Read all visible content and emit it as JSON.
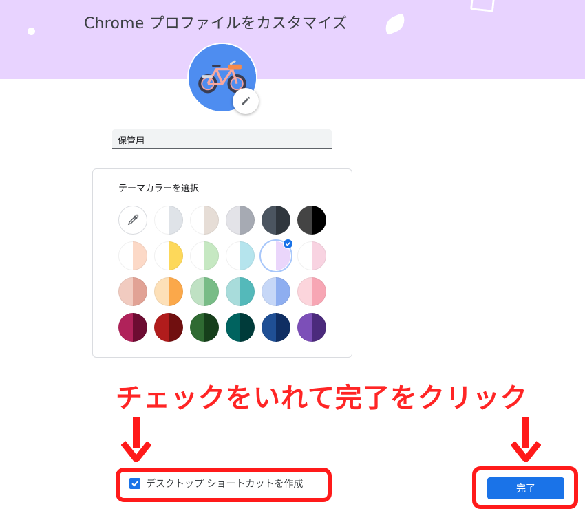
{
  "header": {
    "title": "Chrome プロファイルをカスタマイズ",
    "banner_color": "#e8d3ff"
  },
  "avatar": {
    "icon": "bicycle",
    "background": "#4e8df0",
    "edit_icon": "pencil-icon"
  },
  "profile_name": {
    "value": "保管用"
  },
  "theme": {
    "label": "テーマカラーを選択",
    "selected_index": 10,
    "swatches": [
      {
        "name": "custom-color-picker",
        "left": "#ffffff",
        "right": "#ffffff"
      },
      {
        "name": "grey-light",
        "left": "#ffffff",
        "right": "#dfe3e8"
      },
      {
        "name": "beige-light",
        "left": "#ffffff",
        "right": "#e6ddd6"
      },
      {
        "name": "grey-blue",
        "left": "#e3e3e8",
        "right": "#a6aab3"
      },
      {
        "name": "dark-slate",
        "left": "#4b5560",
        "right": "#2f363d"
      },
      {
        "name": "black",
        "left": "#444444",
        "right": "#000000"
      },
      {
        "name": "peach-light",
        "left": "#ffffff",
        "right": "#fcd9c7"
      },
      {
        "name": "yellow",
        "left": "#ffffff",
        "right": "#fdd85a"
      },
      {
        "name": "green-light",
        "left": "#ffffff",
        "right": "#c6e8c2"
      },
      {
        "name": "cyan-light",
        "left": "#ffffff",
        "right": "#b5e4ed"
      },
      {
        "name": "lavender",
        "left": "#ffffff",
        "right": "#ead6fb"
      },
      {
        "name": "pink-light",
        "left": "#ffffff",
        "right": "#f8d3e1"
      },
      {
        "name": "salmon",
        "left": "#f1cbc0",
        "right": "#e1a295"
      },
      {
        "name": "orange",
        "left": "#fde0b8",
        "right": "#fba84a"
      },
      {
        "name": "green",
        "left": "#bfe1c3",
        "right": "#78bc86"
      },
      {
        "name": "teal",
        "left": "#a8dcdb",
        "right": "#54b9ba"
      },
      {
        "name": "periwinkle",
        "left": "#c6d7f7",
        "right": "#8eaef0"
      },
      {
        "name": "rose",
        "left": "#fcd5dc",
        "right": "#f7a6b4"
      },
      {
        "name": "burgundy",
        "left": "#b0225a",
        "right": "#6d0c32"
      },
      {
        "name": "dark-red",
        "left": "#b11c1c",
        "right": "#700f0f"
      },
      {
        "name": "dark-green",
        "left": "#2f6a32",
        "right": "#163f1b"
      },
      {
        "name": "dark-teal",
        "left": "#00635f",
        "right": "#003b3a"
      },
      {
        "name": "navy",
        "left": "#1f4f95",
        "right": "#0f2e63"
      },
      {
        "name": "purple",
        "left": "#7c4fb8",
        "right": "#4b2a7c"
      }
    ]
  },
  "annotation": {
    "text": "チェックをいれて完了をクリック",
    "color": "#ff2525"
  },
  "shortcut": {
    "label": "デスクトップ ショートカットを作成",
    "checked": true
  },
  "done_button": {
    "label": "完了",
    "color": "#1a73e8"
  }
}
